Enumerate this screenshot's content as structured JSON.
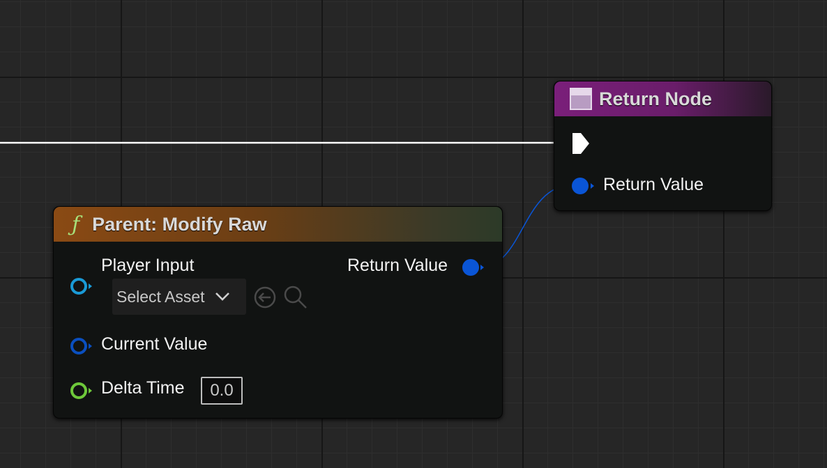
{
  "return_node": {
    "title": "Return Node",
    "icon": "function-entry-icon",
    "header_color": "#7a1f7a",
    "pins": [
      {
        "type": "exec",
        "label": ""
      },
      {
        "type": "object",
        "label": "Return Value",
        "color": "#0a55d6"
      }
    ]
  },
  "parent_node": {
    "title": "Parent: Modify Raw",
    "icon": "function-icon",
    "icon_glyph": "ƒ",
    "header_color": "#8a4a14",
    "inputs": [
      {
        "label": "Player Input",
        "color": "#1a9ad6",
        "asset_picker": {
          "value": "Select Asset"
        }
      },
      {
        "label": "Current Value",
        "color": "#0a4fbf"
      },
      {
        "label": "Delta Time",
        "color": "#6ec83a",
        "default_value": "0.0"
      }
    ],
    "outputs": [
      {
        "label": "Return Value",
        "color": "#0a55d6"
      }
    ]
  }
}
